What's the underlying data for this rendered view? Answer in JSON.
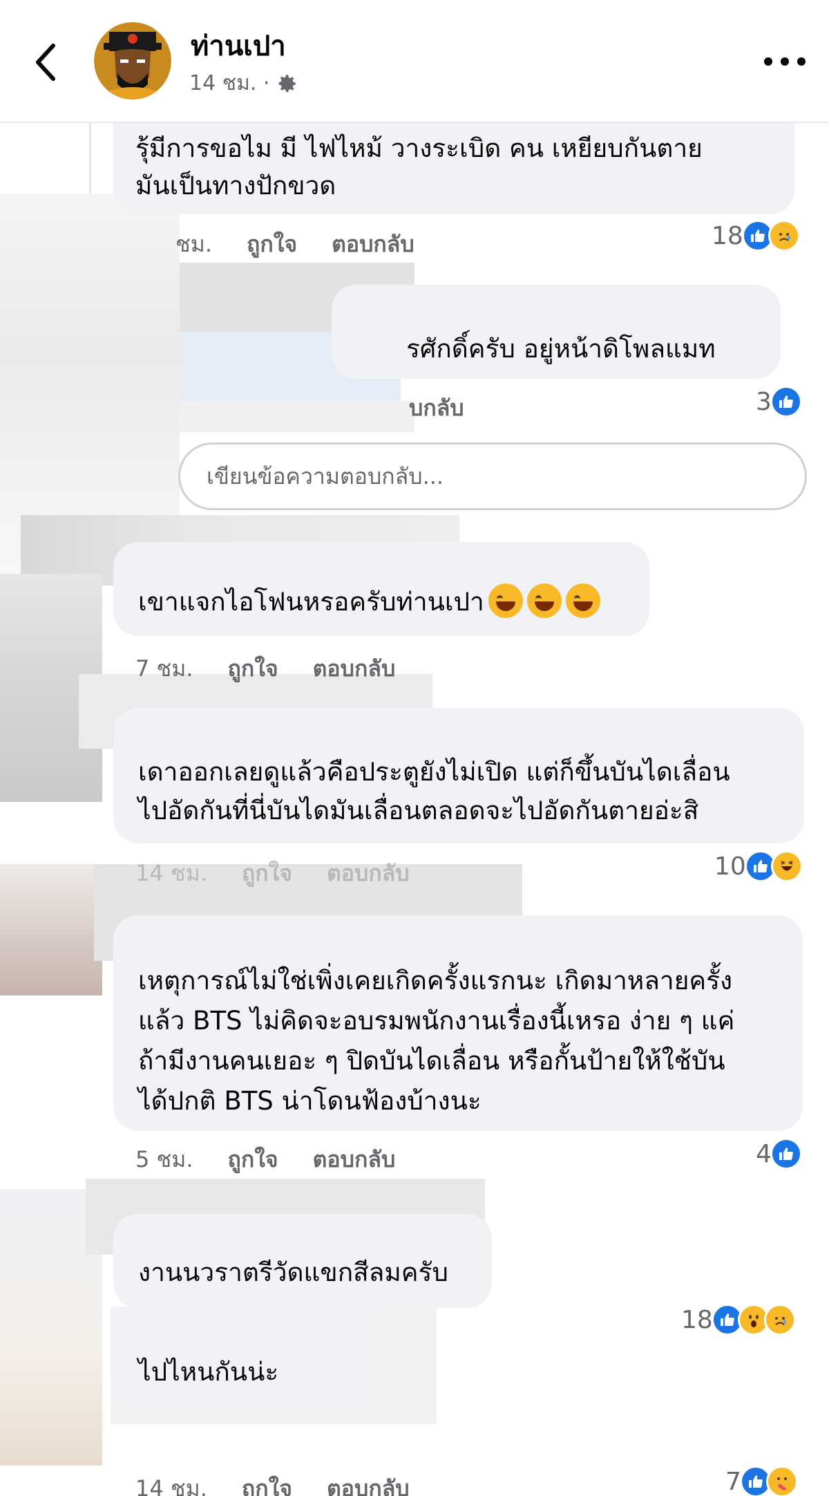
{
  "post": {
    "author": "ท่านเปา",
    "time": "14 ชม. ·"
  },
  "reply_placeholder": "เขียนข้อความตอบกลับ...",
  "comments": [
    {
      "text_lines": [
        "รุ้มีการขอไม มี ไฟไหม้ วางระเบิด คน เหยียบกันตาย",
        "มันเป็นทางปักขวด"
      ],
      "time": "ชม.",
      "like_label": "ถูกใจ",
      "reply_label": "ตอบกลับ",
      "reaction_count": "18",
      "reactions": [
        "like-icon",
        "sad-icon"
      ]
    },
    {
      "text_lines": [
        "รศักดิ์ครับ อยู่หน้าดิโพลแมท"
      ],
      "time": "",
      "like_label": "",
      "reply_label": "บกลับ",
      "reaction_count": "3",
      "reactions": [
        "like-icon"
      ]
    },
    {
      "text_lines": [
        "เขาแจกไอโฟนหรอครับท่านเปา"
      ],
      "time": "7 ชม.",
      "like_label": "ถูกใจ",
      "reply_label": "ตอบกลับ",
      "reaction_count": "",
      "reactions": []
    },
    {
      "text_lines": [
        "เดาออกเลยดูแล้วคือประตูยังไม่เปิด แต่ก็ขึ้นบันไดเลื่อน",
        "ไปอัดกันที่นี่บันไดมันเลื่อนตลอดจะไปอัดกันตายอ่ะสิ"
      ],
      "time": "14 ชม.",
      "like_label": "ถูกใจ",
      "reply_label": "ตอบกลับ",
      "reaction_count": "10",
      "reactions": [
        "like-icon",
        "haha-icon"
      ]
    },
    {
      "text_lines": [
        "เหตุการณ์ไม่ใช่เพิ่งเคยเกิดครั้งแรกนะ เกิดมาหลายครั้ง",
        "แล้ว BTS ไม่คิดจะอบรมพนักงานเรื่องนี้เหรอ ง่าย ๆ แค่",
        "ถ้ามีงานคนเยอะ ๆ ปิดบันไดเลื่อน หรือกั้นป้ายให้ใช้บัน",
        "ได้ปกติ BTS น่าโดนฟ้องบ้างนะ"
      ],
      "time": "5 ชม.",
      "like_label": "ถูกใจ",
      "reply_label": "ตอบกลับ",
      "reaction_count": "4",
      "reactions": [
        "like-icon"
      ]
    },
    {
      "text_lines": [
        "งานนวราตรีวัดแขกสีลมครับ"
      ],
      "time": "",
      "like_label": "",
      "reply_label": "",
      "reaction_count": "18",
      "reactions": [
        "like-icon",
        "wow-icon",
        "sad-icon"
      ]
    },
    {
      "text_lines": [
        "ไปไหนกันน่ะ"
      ],
      "time": "14 ชม.",
      "like_label": "ถูกใจ",
      "reply_label": "ตอบกลับ",
      "reaction_count": "7",
      "reactions": [
        "like-icon",
        "care-icon"
      ]
    }
  ],
  "colors": {
    "bubble": "#f0f2f5",
    "secondary_text": "#65676b",
    "like_blue": "#1b74e4",
    "emoji_yellow": "#f7b928"
  }
}
